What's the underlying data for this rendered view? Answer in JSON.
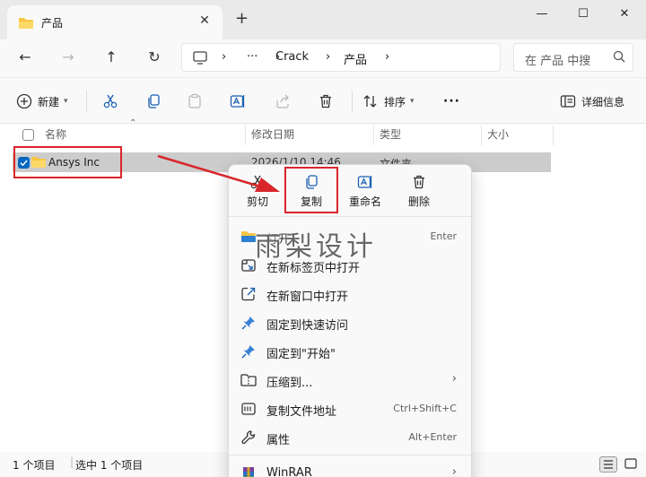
{
  "tab": {
    "title": "产品",
    "close": "✕",
    "add": "+"
  },
  "window": {
    "minimize": "—",
    "maximize": "☐",
    "close": "✕"
  },
  "address": {
    "more": "···",
    "crumbs": [
      "Crack",
      "产品"
    ],
    "sep": "›"
  },
  "search": {
    "placeholder": "在 产品 中搜"
  },
  "commands": {
    "new_label": "新建",
    "sort_label": "排序",
    "more": "···",
    "details_label": "详细信息"
  },
  "columns": {
    "name": "名称",
    "date": "修改日期",
    "type": "类型",
    "size": "大小"
  },
  "file": {
    "name": "Ansys Inc",
    "date": "2026/1/10 14:46",
    "type": "文件夹"
  },
  "status": {
    "count": "1 个项目",
    "selected": "选中 1 个项目"
  },
  "context_menu": {
    "quick": {
      "cut": "剪切",
      "copy": "复制",
      "rename": "重命名",
      "delete": "删除"
    },
    "items": [
      {
        "label": "打开",
        "shortcut": "Enter"
      },
      {
        "label": "在新标签页中打开",
        "shortcut": ""
      },
      {
        "label": "在新窗口中打开",
        "shortcut": ""
      },
      {
        "label": "固定到快速访问",
        "shortcut": ""
      },
      {
        "label": "固定到\"开始\"",
        "shortcut": ""
      },
      {
        "label": "压缩到...",
        "shortcut": ""
      },
      {
        "label": "复制文件地址",
        "shortcut": "Ctrl+Shift+C"
      },
      {
        "label": "属性",
        "shortcut": "Alt+Enter"
      },
      {
        "label": "WinRAR",
        "shortcut": ""
      }
    ],
    "arrow": "›"
  },
  "watermark": "雨梨设计",
  "colors": {
    "accent": "#0067c0",
    "folder": "#f7c641",
    "highlight": "#d8262b",
    "selection": "#cccccc"
  }
}
